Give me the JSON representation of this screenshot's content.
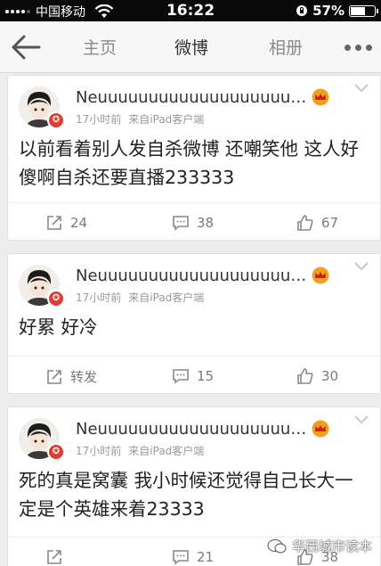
{
  "status_bar": {
    "carrier": "中国移动",
    "time": "16:22",
    "battery": "57%",
    "battery_level": 0.57
  },
  "nav": {
    "tabs": [
      {
        "label": "主页"
      },
      {
        "label": "微博"
      },
      {
        "label": "相册"
      }
    ],
    "active_tab": "微博"
  },
  "posts": [
    {
      "username": "Neuuuuuuuuuuuuuuuuuuuuu...",
      "time": "17小时前",
      "source": "来自iPad客户端",
      "text": "以前看着别人发自杀微博 还嘲笑他 这人好傻啊自杀还要直播233333",
      "repost": "24",
      "comments": "38",
      "likes": "67"
    },
    {
      "username": "Neuuuuuuuuuuuuuuuuuuuuu...",
      "time": "17小时前",
      "source": "来自iPad客户端",
      "text": "好累 好冷",
      "repost": "转发",
      "comments": "15",
      "likes": "30"
    },
    {
      "username": "Neuuuuuuuuuuuuuuuuuuuuu...",
      "time": "17小时前",
      "source": "来自iPad客户端",
      "text": "死的真是窝囊 我小时候还觉得自己长大一定是个英雄来着23333",
      "repost": "",
      "comments": "21",
      "likes": "38"
    }
  ],
  "watermark": "华西城市读本",
  "colors": {
    "vip_badge": "#e03c31",
    "crown": "#f0a020",
    "background": "#ededed"
  }
}
